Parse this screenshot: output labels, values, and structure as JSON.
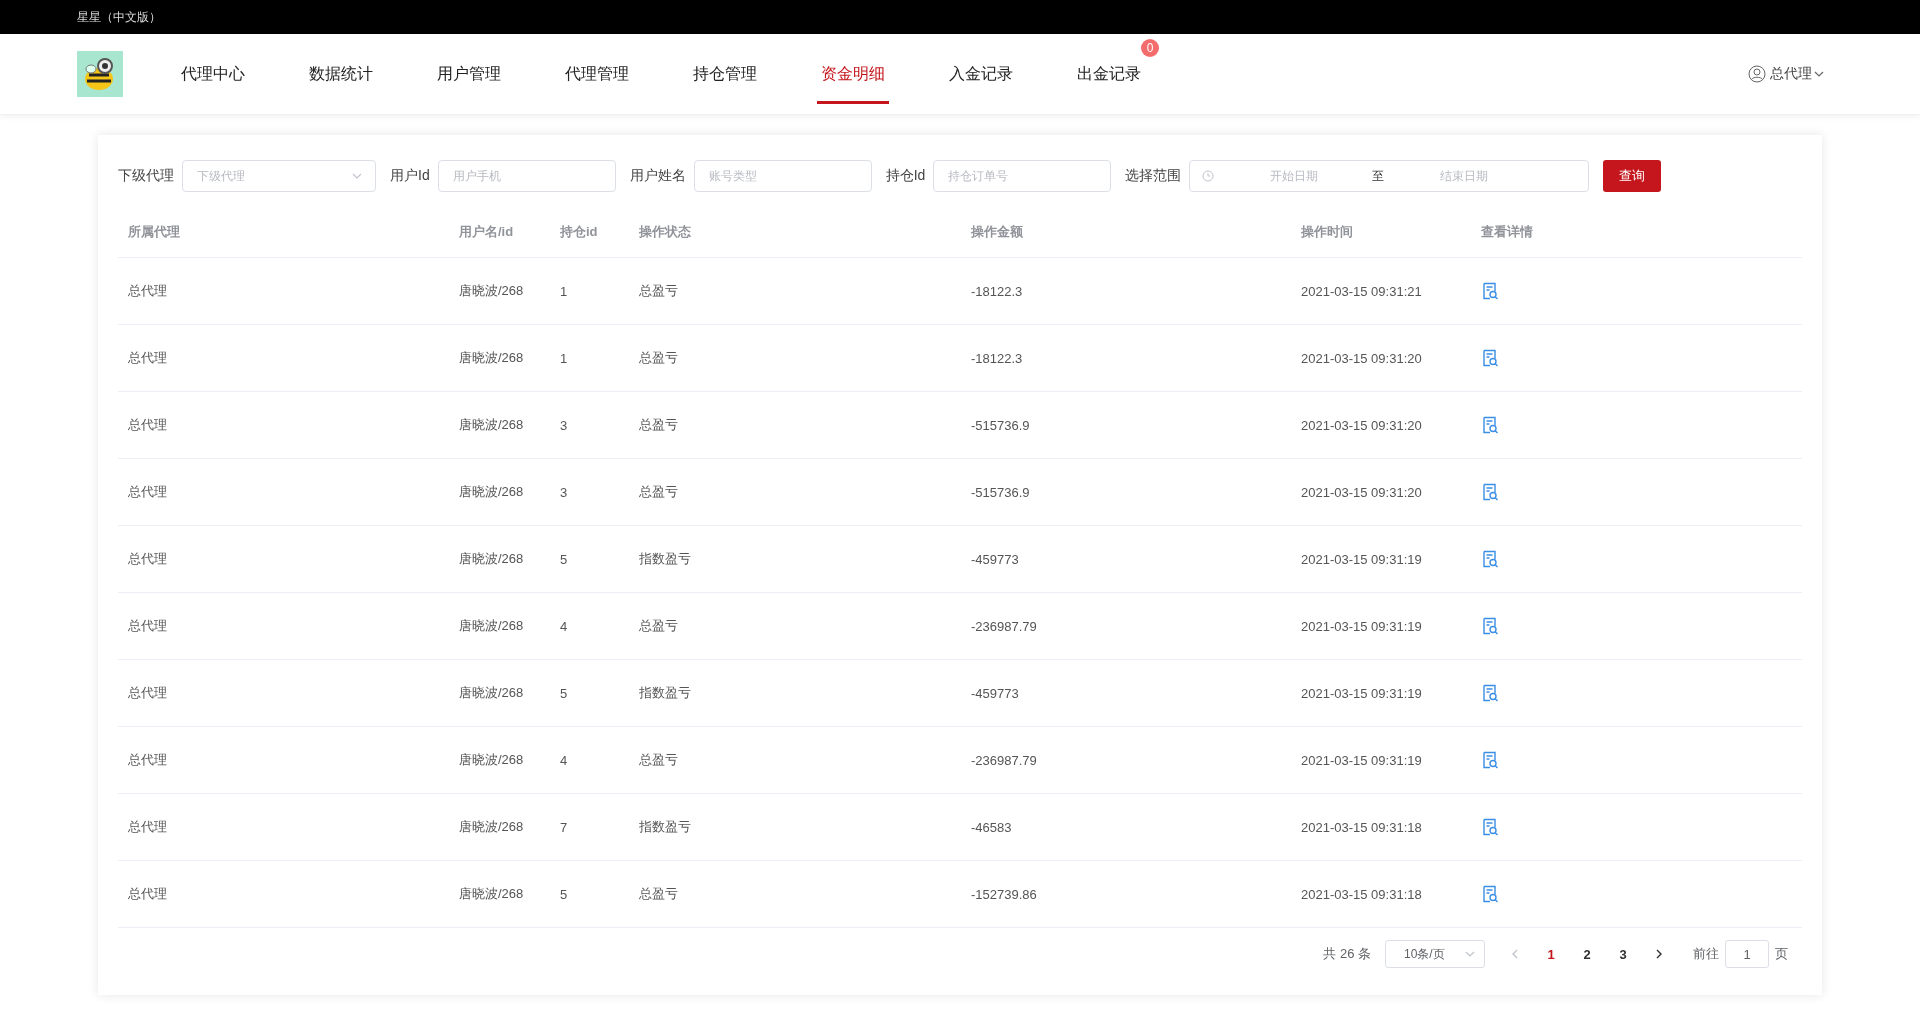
{
  "app_title": "星星（中文版）",
  "nav": {
    "tabs": [
      {
        "label": "代理中心",
        "selected": false
      },
      {
        "label": "数据统计",
        "selected": false
      },
      {
        "label": "用户管理",
        "selected": false
      },
      {
        "label": "代理管理",
        "selected": false
      },
      {
        "label": "持仓管理",
        "selected": false
      },
      {
        "label": "资金明细",
        "selected": true
      },
      {
        "label": "入金记录",
        "selected": false
      },
      {
        "label": "出金记录",
        "selected": false,
        "badge": "0"
      }
    ],
    "user": "总代理"
  },
  "filters": [
    {
      "kind": "select",
      "label": "下级代理",
      "placeholder": "下级代理"
    },
    {
      "kind": "text",
      "label": "用户Id",
      "placeholder": "用户手机"
    },
    {
      "kind": "text",
      "label": "用户姓名",
      "placeholder": "账号类型"
    },
    {
      "kind": "text",
      "label": "持仓Id",
      "placeholder": "持仓订单号"
    },
    {
      "kind": "daterange",
      "label": "选择范围",
      "start_placeholder": "开始日期",
      "separator": "至",
      "end_placeholder": "结束日期"
    }
  ],
  "query_button": "查询",
  "table": {
    "columns": [
      "所属代理",
      "用户名/id",
      "持仓id",
      "操作状态",
      "操作金额",
      "操作时间",
      "查看详情"
    ],
    "rows": [
      {
        "agent": "总代理",
        "user": "唐晓波/268",
        "position_id": "1",
        "status": "总盈亏",
        "amount": "-18122.3",
        "time": "2021-03-15 09:31:21"
      },
      {
        "agent": "总代理",
        "user": "唐晓波/268",
        "position_id": "1",
        "status": "总盈亏",
        "amount": "-18122.3",
        "time": "2021-03-15 09:31:20"
      },
      {
        "agent": "总代理",
        "user": "唐晓波/268",
        "position_id": "3",
        "status": "总盈亏",
        "amount": "-515736.9",
        "time": "2021-03-15 09:31:20"
      },
      {
        "agent": "总代理",
        "user": "唐晓波/268",
        "position_id": "3",
        "status": "总盈亏",
        "amount": "-515736.9",
        "time": "2021-03-15 09:31:20"
      },
      {
        "agent": "总代理",
        "user": "唐晓波/268",
        "position_id": "5",
        "status": "指数盈亏",
        "amount": "-459773",
        "time": "2021-03-15 09:31:19"
      },
      {
        "agent": "总代理",
        "user": "唐晓波/268",
        "position_id": "4",
        "status": "总盈亏",
        "amount": "-236987.79",
        "time": "2021-03-15 09:31:19"
      },
      {
        "agent": "总代理",
        "user": "唐晓波/268",
        "position_id": "5",
        "status": "指数盈亏",
        "amount": "-459773",
        "time": "2021-03-15 09:31:19"
      },
      {
        "agent": "总代理",
        "user": "唐晓波/268",
        "position_id": "4",
        "status": "总盈亏",
        "amount": "-236987.79",
        "time": "2021-03-15 09:31:19"
      },
      {
        "agent": "总代理",
        "user": "唐晓波/268",
        "position_id": "7",
        "status": "指数盈亏",
        "amount": "-46583",
        "time": "2021-03-15 09:31:18"
      },
      {
        "agent": "总代理",
        "user": "唐晓波/268",
        "position_id": "5",
        "status": "总盈亏",
        "amount": "-152739.86",
        "time": "2021-03-15 09:31:18"
      }
    ]
  },
  "pagination": {
    "total": "共 26 条",
    "page_size": "10条/页",
    "pages": [
      {
        "label": "1",
        "selected": true
      },
      {
        "label": "2",
        "selected": false
      },
      {
        "label": "3",
        "selected": false
      }
    ],
    "goto_label": "前往",
    "goto_value": "1",
    "page_suffix": "页"
  }
}
